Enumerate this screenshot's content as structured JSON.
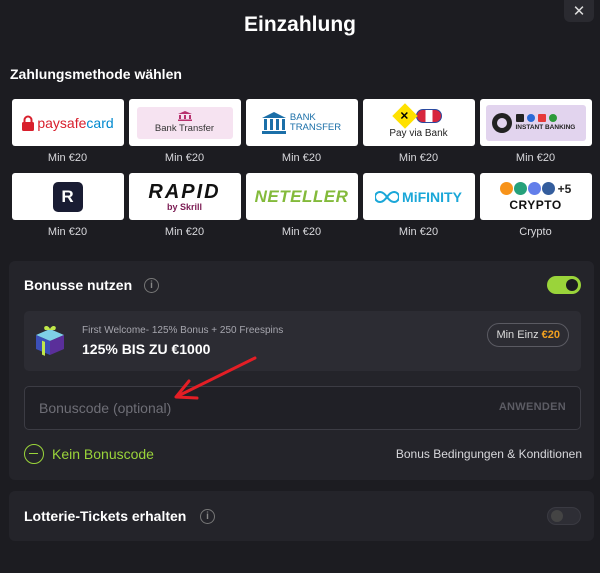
{
  "header": {
    "title": "Einzahlung",
    "close_glyph": "✕"
  },
  "methods": {
    "section_label": "Zahlungsmethode wählen",
    "items": [
      {
        "name": "paysafecard",
        "label": "Min €20",
        "logo_text": "paysafecard",
        "logo_prefix": "paysafe",
        "logo_suffix": "card"
      },
      {
        "name": "bank-transfer-1",
        "label": "Min €20",
        "logo_text": "Bank Transfer"
      },
      {
        "name": "bank-transfer-2",
        "label": "Min €20",
        "logo_line1": "BANK",
        "logo_line2": "TRANSFER"
      },
      {
        "name": "pay-via-bank",
        "label": "Min €20",
        "logo_text": "Pay via Bank"
      },
      {
        "name": "instant-banking",
        "label": "Min €20",
        "logo_text": "INSTANT BANKING"
      },
      {
        "name": "revolut",
        "label": "Min €20",
        "logo_text": "R"
      },
      {
        "name": "rapid-transfer",
        "label": "Min €20",
        "logo_text": "RAPID",
        "logo_sub": "by Skrill"
      },
      {
        "name": "neteller",
        "label": "Min €20",
        "logo_text": "NETELLER"
      },
      {
        "name": "mifinity",
        "label": "Min €20",
        "logo_text": "MiFINITY"
      },
      {
        "name": "crypto",
        "label": "Crypto",
        "logo_text": "CRYPTO",
        "logo_plus": "+5"
      }
    ]
  },
  "bonus": {
    "title": "Bonusse nutzen",
    "toggle_on": true,
    "offer_sub": "First Welcome- 125% Bonus + 250 Freespins",
    "offer_main": "125% BIS ZU €1000",
    "min_label": "Min Einz",
    "min_amount": "€20",
    "code_value": "",
    "code_placeholder": "Bonuscode (optional)",
    "apply_label": "ANWENDEN",
    "no_bonus_label": "Kein Bonuscode",
    "terms_label": "Bonus Bedingungen & Konditionen"
  },
  "lottery": {
    "title": "Lotterie-Tickets erhalten",
    "toggle_on": false
  },
  "colors": {
    "accent_green": "#9ad43a",
    "amount_orange": "#f0a020",
    "arrow_red": "#e41e25"
  }
}
